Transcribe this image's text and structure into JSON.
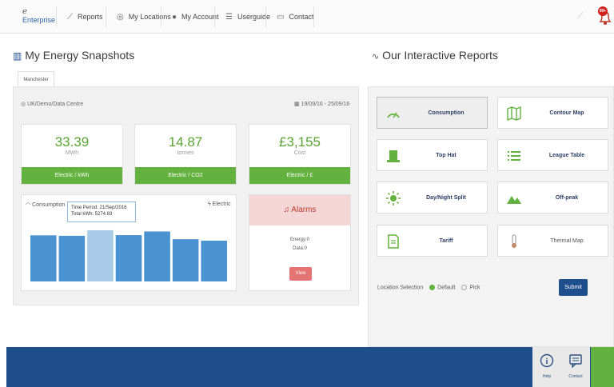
{
  "nav": {
    "logo_top": "ℯ",
    "logo_text": "Enterprise",
    "items": [
      {
        "label": "Reports",
        "icon": "line-chart-icon"
      },
      {
        "label": "My Locations",
        "icon": "location-pin-icon"
      },
      {
        "label": "My Account",
        "icon": "user-icon"
      },
      {
        "label": "Userguide",
        "icon": "list-icon"
      },
      {
        "label": "Contact",
        "icon": "chat-icon"
      }
    ],
    "alert_count": "99+"
  },
  "snapshots": {
    "title": "My Energy Snapshots",
    "tab": "Manchester",
    "location": "UK/Demo/Data Centre",
    "date_range": "19/09/16 - 25/09/16",
    "stats": [
      {
        "value": "33.39",
        "unit": "MWh",
        "bar": "Electric / kWh"
      },
      {
        "value": "14.87",
        "unit": "tonnes",
        "bar": "Electric / CO2"
      },
      {
        "value": "£3,155",
        "unit": "Cost",
        "bar": "Electric / £"
      }
    ],
    "chart": {
      "title": "Consumption",
      "type_label": "Electric",
      "tooltip_line1": "Time Period: 21/Sep/2016",
      "tooltip_line2": "Total kWh: 5274.83"
    },
    "alarms": {
      "title": "Alarms",
      "energy_label": "Energy:",
      "energy_value": "0",
      "data_label": "Data:",
      "data_value": "0",
      "view_label": "View"
    }
  },
  "chart_data": {
    "type": "bar",
    "categories": [
      "",
      "",
      "",
      "",
      "",
      "",
      ""
    ],
    "values": [
      4750,
      4700,
      5274.83,
      4770,
      5150,
      4350,
      4200
    ],
    "highlight_index": 2,
    "bar_color": "#4a93d2",
    "highlight_color": "#a9cbe8"
  },
  "reports": {
    "title": "Our Interactive Reports",
    "items": [
      {
        "label": "Consumption",
        "icon": "gauge-icon",
        "active": true
      },
      {
        "label": "Contour Map",
        "icon": "map-icon",
        "active": false
      },
      {
        "label": "Top Hat",
        "icon": "top-hat-icon",
        "active": false
      },
      {
        "label": "League Table",
        "icon": "list-icon",
        "active": false
      },
      {
        "label": "Day/Night Split",
        "icon": "sun-icon",
        "active": false
      },
      {
        "label": "Off-peak",
        "icon": "mountain-icon",
        "active": false
      },
      {
        "label": "Tariff",
        "icon": "document-icon",
        "active": false
      },
      {
        "label": "Thermal Map",
        "icon": "thermometer-icon",
        "active": false
      }
    ],
    "location_selection_label": "Location Selection",
    "default_label": "Default",
    "pick_label": "Pick",
    "submit_label": "Submit"
  },
  "footer": {
    "help_label": "Help",
    "contact_label": "Contact"
  }
}
